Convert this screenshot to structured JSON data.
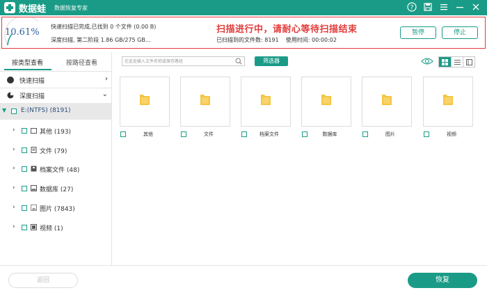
{
  "titlebar": {
    "app_name": "数据蛙",
    "subtitle": "数据恢复专家",
    "icons": [
      "help-icon",
      "save-icon",
      "menu-icon",
      "minimize-icon",
      "close-icon"
    ],
    "accent": "#1a9b87"
  },
  "progress": {
    "percent_text": "10.61%",
    "percent_value": 10.61,
    "quick_scan_status": "快速扫描已完成,已找到 0 个文件 (0.00  B)",
    "deep_scan_status": "深度扫描, 第二阶段  1.86 GB/275 GB...",
    "scanning_message": "扫描进行中，请耐心等待扫描结束",
    "found_files_label": "已扫描到的文件数:  8191",
    "elapsed_label": "使用时间:  00:00:02",
    "pause_label": "暂停",
    "stop_label": "停止",
    "message_color": "#e23b3b"
  },
  "left": {
    "tabs": [
      {
        "label": "按类型查看",
        "active": true
      },
      {
        "label": "按路径查看",
        "active": false
      }
    ],
    "quick_scan": "快速扫描",
    "deep_scan": "深度扫描",
    "drive_label": "E:(NTFS) (8191)",
    "tree": [
      {
        "label": "其他 (193)",
        "icon": "folder-icon"
      },
      {
        "label": "文件 (79)",
        "icon": "document-icon"
      },
      {
        "label": "档案文件 (48)",
        "icon": "archive-icon"
      },
      {
        "label": "数据库 (27)",
        "icon": "database-icon"
      },
      {
        "label": "图片 (7843)",
        "icon": "image-icon"
      },
      {
        "label": "视频 (1)",
        "icon": "video-icon"
      }
    ]
  },
  "toolbar": {
    "search_placeholder": "在此处输入文件名称或保存路径",
    "filter_label": "筛选器"
  },
  "grid": {
    "folder_color": "#f5c542",
    "items": [
      "其他",
      "文件",
      "档案文件",
      "数据库",
      "图片",
      "视频"
    ]
  },
  "bottom": {
    "back_label": "返回",
    "recover_label": "恢复"
  }
}
